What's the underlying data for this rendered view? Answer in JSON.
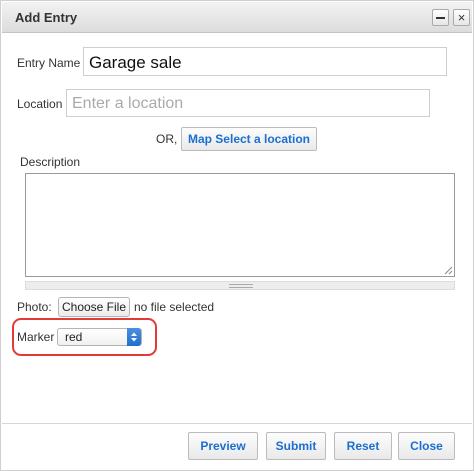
{
  "window": {
    "title": "Add Entry",
    "close_glyph": "×"
  },
  "form": {
    "entry_name_label": "Entry Name",
    "entry_name_value": "Garage sale",
    "location_label": "Location",
    "location_placeholder": "Enter a location",
    "or_text": "OR,",
    "map_button_label": "Map Select a location",
    "description_label": "Description",
    "description_value": "",
    "photo_label": "Photo:",
    "choose_file_label": "Choose File",
    "file_status": "no file selected",
    "marker_label": "Marker",
    "marker_value": "red"
  },
  "footer": {
    "preview_label": "Preview",
    "submit_label": "Submit",
    "reset_label": "Reset",
    "close_label": "Close"
  },
  "colors": {
    "accent": "#1a6fd1",
    "highlight": "#e53935"
  }
}
